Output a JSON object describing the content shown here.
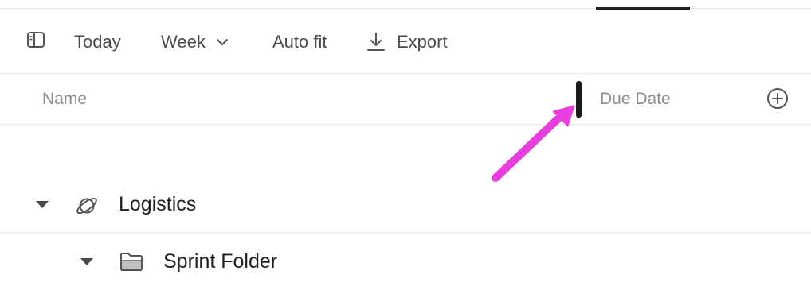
{
  "toolbar": {
    "sidebar_toggle_icon": "sidebar-panel-icon",
    "today_label": "Today",
    "week_label": "Week",
    "week_icon": "chevron-down-icon",
    "autofit_label": "Auto fit",
    "export_label": "Export",
    "export_icon": "download-icon"
  },
  "columns": {
    "name_label": "Name",
    "due_date_label": "Due Date",
    "add_icon": "plus-circle-icon"
  },
  "annotation": {
    "arrow_color": "#e83ee0"
  },
  "rows": [
    {
      "label": "Logistics",
      "icon": "planet-icon",
      "caret": "caret-down-icon"
    },
    {
      "label": "Sprint Folder",
      "icon": "folder-icon",
      "caret": "caret-down-icon"
    }
  ]
}
